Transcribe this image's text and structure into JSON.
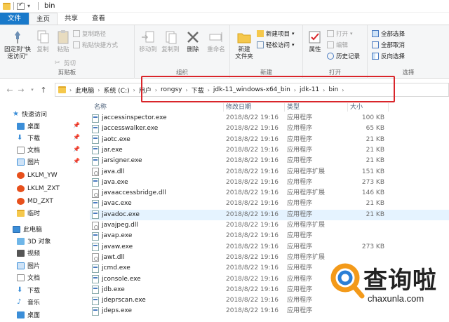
{
  "window": {
    "title": "bin"
  },
  "tabs": [
    {
      "label": "文件"
    },
    {
      "label": "主页"
    },
    {
      "label": "共享"
    },
    {
      "label": "查看"
    }
  ],
  "ribbon": {
    "clipboard": {
      "label": "剪贴板",
      "pin": "固定到\"快速访问\"",
      "copy": "复制",
      "paste": "粘贴",
      "copy_path": "复制路径",
      "paste_shortcut": "粘贴快捷方式",
      "cut": "剪切"
    },
    "organize": {
      "label": "组织",
      "move_to": "移动到",
      "copy_to": "复制到",
      "delete": "删除",
      "rename": "重命名"
    },
    "new": {
      "label": "新建",
      "new_folder": "新建\n文件夹",
      "new_item": "新建项目",
      "easy_access": "轻松访问"
    },
    "open": {
      "label": "打开",
      "properties": "属性",
      "open": "打开",
      "edit": "编辑",
      "history": "历史记录"
    },
    "select": {
      "label": "选择",
      "select_all": "全部选择",
      "select_none": "全部取消",
      "invert": "反向选择"
    }
  },
  "address": {
    "crumbs": [
      "此电脑",
      "系统 (C:)",
      "用户",
      "rongsy",
      "下载",
      "jdk-11_windows-x64_bin",
      "jdk-11",
      "bin"
    ]
  },
  "sidebar": {
    "quick_access": "快速访问",
    "items": [
      {
        "label": "桌面",
        "pinned": true
      },
      {
        "label": "下载",
        "pinned": true
      },
      {
        "label": "文档",
        "pinned": true
      },
      {
        "label": "图片",
        "pinned": true
      },
      {
        "label": "LKLM_YW",
        "pinned": false
      },
      {
        "label": "LKLM_ZXT",
        "pinned": false
      },
      {
        "label": "MD_ZXT",
        "pinned": false
      },
      {
        "label": "临时",
        "pinned": false
      }
    ],
    "this_pc": "此电脑",
    "pc_items": [
      {
        "label": "3D 对象"
      },
      {
        "label": "视频"
      },
      {
        "label": "图片"
      },
      {
        "label": "文档"
      },
      {
        "label": "下载"
      },
      {
        "label": "音乐"
      },
      {
        "label": "桌面"
      }
    ]
  },
  "columns": {
    "name": "名称",
    "date": "修改日期",
    "type": "类型",
    "size": "大小"
  },
  "files": [
    {
      "name": "jaccessinspector.exe",
      "date": "2018/8/22 19:16",
      "type": "应用程序",
      "size": "100 KB",
      "kind": "exe"
    },
    {
      "name": "jaccesswalker.exe",
      "date": "2018/8/22 19:16",
      "type": "应用程序",
      "size": "65 KB",
      "kind": "exe"
    },
    {
      "name": "jaotc.exe",
      "date": "2018/8/22 19:16",
      "type": "应用程序",
      "size": "21 KB",
      "kind": "exe"
    },
    {
      "name": "jar.exe",
      "date": "2018/8/22 19:16",
      "type": "应用程序",
      "size": "21 KB",
      "kind": "exe"
    },
    {
      "name": "jarsigner.exe",
      "date": "2018/8/22 19:16",
      "type": "应用程序",
      "size": "21 KB",
      "kind": "exe"
    },
    {
      "name": "java.dll",
      "date": "2018/8/22 19:16",
      "type": "应用程序扩展",
      "size": "151 KB",
      "kind": "dll"
    },
    {
      "name": "java.exe",
      "date": "2018/8/22 19:16",
      "type": "应用程序",
      "size": "273 KB",
      "kind": "exe"
    },
    {
      "name": "javaaccessbridge.dll",
      "date": "2018/8/22 19:16",
      "type": "应用程序扩展",
      "size": "146 KB",
      "kind": "dll"
    },
    {
      "name": "javac.exe",
      "date": "2018/8/22 19:16",
      "type": "应用程序",
      "size": "21 KB",
      "kind": "exe"
    },
    {
      "name": "javadoc.exe",
      "date": "2018/8/22 19:16",
      "type": "应用程序",
      "size": "21 KB",
      "kind": "exe"
    },
    {
      "name": "javajpeg.dll",
      "date": "2018/8/22 19:16",
      "type": "应用程序扩展",
      "size": "",
      "kind": "dll"
    },
    {
      "name": "javap.exe",
      "date": "2018/8/22 19:16",
      "type": "应用程序",
      "size": "",
      "kind": "exe"
    },
    {
      "name": "javaw.exe",
      "date": "2018/8/22 19:16",
      "type": "应用程序",
      "size": "273 KB",
      "kind": "exe"
    },
    {
      "name": "jawt.dll",
      "date": "2018/8/22 19:16",
      "type": "应用程序扩展",
      "size": "",
      "kind": "dll"
    },
    {
      "name": "jcmd.exe",
      "date": "2018/8/22 19:16",
      "type": "应用程序",
      "size": "",
      "kind": "exe"
    },
    {
      "name": "jconsole.exe",
      "date": "2018/8/22 19:16",
      "type": "应用程序",
      "size": "",
      "kind": "exe"
    },
    {
      "name": "jdb.exe",
      "date": "2018/8/22 19:16",
      "type": "应用程序",
      "size": "",
      "kind": "exe"
    },
    {
      "name": "jdeprscan.exe",
      "date": "2018/8/22 19:16",
      "type": "应用程序",
      "size": "",
      "kind": "exe"
    },
    {
      "name": "jdeps.exe",
      "date": "2018/8/22 19:16",
      "type": "应用程序",
      "size": "",
      "kind": "exe"
    }
  ],
  "watermark": {
    "text": "查询啦",
    "url": "chaxunla.com"
  },
  "colors": {
    "accent": "#1979ca",
    "highlight_box": "#d9252a",
    "selected_row": "#e5f3ff"
  }
}
